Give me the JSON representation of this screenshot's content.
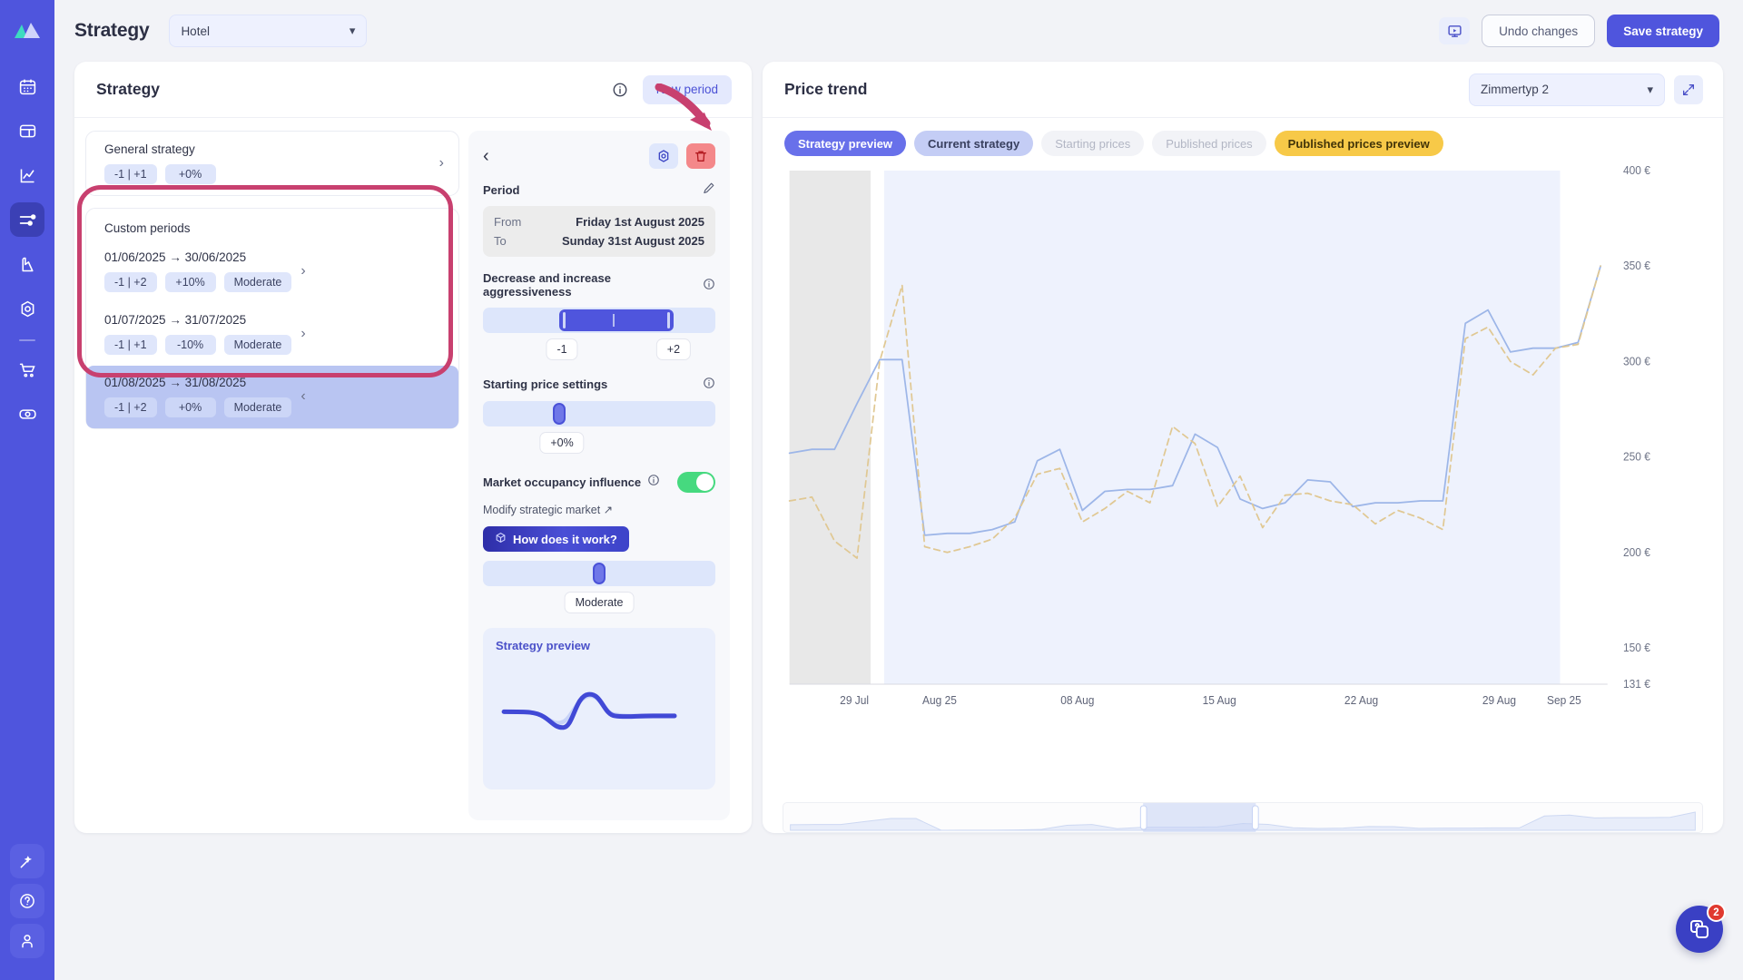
{
  "sidebar": {
    "logo_icon": "mountain-logo-icon",
    "items": [
      {
        "icon": "calendar-icon",
        "name": "calendar",
        "active": false
      },
      {
        "icon": "dashboard-icon",
        "name": "dashboard",
        "active": false
      },
      {
        "icon": "analytics-chart-icon",
        "name": "analytics",
        "active": false
      },
      {
        "icon": "sliders-icon",
        "name": "strategy",
        "active": true
      },
      {
        "icon": "flag-icon",
        "name": "benchmark",
        "active": false
      },
      {
        "icon": "gear-icon",
        "name": "settings",
        "active": false
      }
    ],
    "items_after_sep": [
      {
        "icon": "cart-icon",
        "name": "shop",
        "active": false
      },
      {
        "icon": "money-icon",
        "name": "revenue",
        "active": false
      }
    ],
    "bottom_items": [
      {
        "icon": "magic-wand-icon",
        "name": "assistant"
      },
      {
        "icon": "question-circle-icon",
        "name": "help"
      },
      {
        "icon": "user-icon",
        "name": "account"
      }
    ]
  },
  "topbar": {
    "title": "Strategy",
    "hotel_select_value": "Hotel",
    "present_icon": "presentation-icon",
    "undo_label": "Undo changes",
    "save_label": "Save strategy"
  },
  "left_panel": {
    "header": "Strategy",
    "info_icon": "info-icon",
    "new_period_label": "New period",
    "general": {
      "title": "General strategy",
      "chips": [
        "-1 | +1",
        "+0%"
      ]
    },
    "custom_label": "Custom periods",
    "periods": [
      {
        "title": "01/06/2025 → 30/06/2025",
        "chips": [
          "-1 | +2",
          "+10%",
          "Moderate"
        ],
        "selected": false
      },
      {
        "title": "01/07/2025 → 31/07/2025",
        "chips": [
          "-1 | +1",
          "-10%",
          "Moderate"
        ],
        "selected": false
      },
      {
        "title": "01/08/2025 → 31/08/2025",
        "chips": [
          "-1 | +2",
          "+0%",
          "Moderate"
        ],
        "selected": true
      }
    ]
  },
  "detail_panel": {
    "back_icon": "chevron-left-icon",
    "gear_icon": "gear-icon",
    "delete_icon": "trash-icon",
    "period_label": "Period",
    "edit_icon": "pencil-icon",
    "from_label": "From",
    "from_value": "Friday 1st August 2025",
    "to_label": "To",
    "to_value": "Sunday 31st August 2025",
    "aggressiveness_label": "Decrease and increase aggressiveness",
    "aggressiveness_min": "-1",
    "aggressiveness_max": "+2",
    "starting_price_label": "Starting price settings",
    "starting_price_value": "+0%",
    "market_occupancy_label": "Market occupancy influence",
    "market_occupancy_on": true,
    "modify_market_label": "Modify strategic market ↗",
    "how_works_label": "How does it work?",
    "how_works_icon": "cube-icon",
    "influence_value": "Moderate",
    "preview_title": "Strategy preview"
  },
  "right_panel": {
    "header": "Price trend",
    "room_select_value": "Zimmertyp 2",
    "expand_icon": "expand-arrows-icon",
    "tabs": [
      {
        "label": "Strategy preview",
        "style": "blue"
      },
      {
        "label": "Current strategy",
        "style": "lblue"
      },
      {
        "label": "Starting prices",
        "style": "grey"
      },
      {
        "label": "Published prices",
        "style": "grey"
      },
      {
        "label": "Published prices preview",
        "style": "yellow"
      }
    ]
  },
  "chat": {
    "icon": "chat-help-icon",
    "badge": "2"
  },
  "chart_data": {
    "type": "line",
    "title": "Price trend",
    "xlabel": "",
    "ylabel": "",
    "ylim": [
      131,
      400
    ],
    "ytick_labels": [
      "400 €",
      "350 €",
      "300 €",
      "250 €",
      "200 €",
      "150 €",
      "131 €"
    ],
    "ytick_values": [
      400,
      350,
      300,
      250,
      200,
      150,
      131
    ],
    "xtick_labels": [
      "29 Jul",
      "Aug 25",
      "08 Aug",
      "15 Aug",
      "22 Aug",
      "29 Aug",
      "Sep 25"
    ],
    "grid": false,
    "legend": "none",
    "highlight_bands": [
      {
        "name": "past-band",
        "from_x": 0,
        "to_x": 3.6,
        "color": "#e8e8e8"
      },
      {
        "name": "selected-period-band",
        "from_x": 4.2,
        "to_x": 34.2,
        "color": "#eef2fd"
      }
    ],
    "series": [
      {
        "name": "Current strategy",
        "color": "#9db6e8",
        "dash": "solid",
        "values": [
          252,
          254,
          254,
          278,
          301,
          301,
          209,
          210,
          210,
          212,
          216,
          248,
          254,
          222,
          232,
          233,
          233,
          235,
          262,
          255,
          228,
          223,
          226,
          238,
          237,
          224,
          226,
          226,
          227,
          227,
          320,
          327,
          305,
          307,
          307,
          310,
          350
        ]
      },
      {
        "name": "Strategy preview",
        "color": "#e0c893",
        "dash": "dashed",
        "values": [
          227,
          229,
          206,
          197,
          300,
          340,
          203,
          200,
          203,
          207,
          218,
          241,
          244,
          216,
          223,
          232,
          226,
          266,
          257,
          224,
          240,
          213,
          230,
          231,
          227,
          225,
          215,
          222,
          218,
          212,
          312,
          318,
          300,
          293,
          307,
          309,
          350
        ]
      }
    ]
  }
}
